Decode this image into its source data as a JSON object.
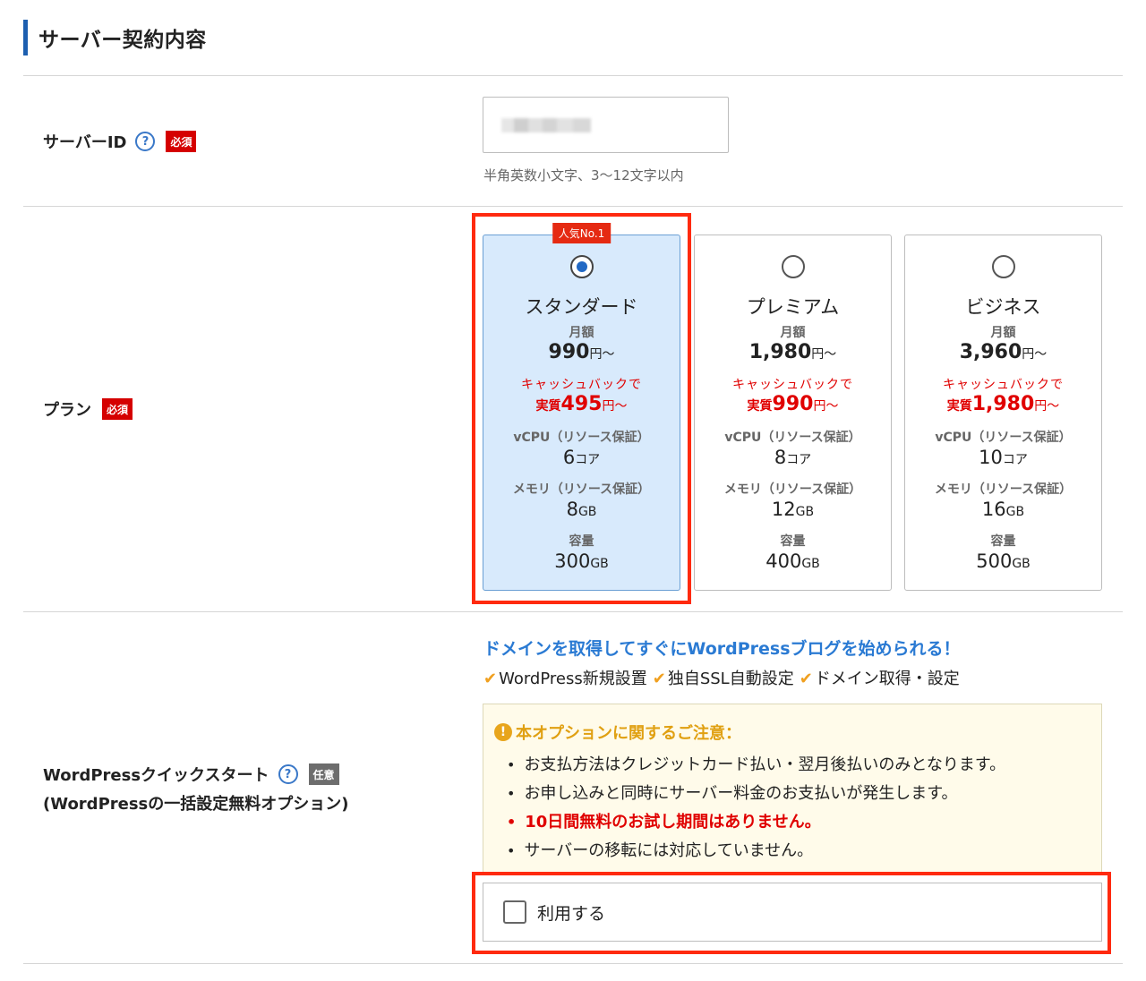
{
  "section": {
    "title": "サーバー契約内容"
  },
  "server_id": {
    "label": "サーバーID",
    "help_icon": "?",
    "required_badge": "必須",
    "hint": "半角英数小文字、3〜12文字以内"
  },
  "plan": {
    "label": "プラン",
    "required_badge": "必須",
    "popular_badge": "人気No.1",
    "selected": "スタンダード",
    "cards": [
      {
        "name": "スタンダード",
        "monthly_label": "月額",
        "price": "990",
        "price_unit": "円〜",
        "cashback_text": "キャッシュバックで",
        "real_prefix": "実質",
        "real_price": "495",
        "real_unit": "円〜",
        "vcpu_label": "vCPU（リソース保証）",
        "vcpu": "6",
        "vcpu_unit": "コア",
        "memory_label": "メモリ（リソース保証）",
        "memory": "8",
        "memory_unit": "GB",
        "storage_label": "容量",
        "storage": "300",
        "storage_unit": "GB"
      },
      {
        "name": "プレミアム",
        "monthly_label": "月額",
        "price": "1,980",
        "price_unit": "円〜",
        "cashback_text": "キャッシュバックで",
        "real_prefix": "実質",
        "real_price": "990",
        "real_unit": "円〜",
        "vcpu_label": "vCPU（リソース保証）",
        "vcpu": "8",
        "vcpu_unit": "コア",
        "memory_label": "メモリ（リソース保証）",
        "memory": "12",
        "memory_unit": "GB",
        "storage_label": "容量",
        "storage": "400",
        "storage_unit": "GB"
      },
      {
        "name": "ビジネス",
        "monthly_label": "月額",
        "price": "3,960",
        "price_unit": "円〜",
        "cashback_text": "キャッシュバックで",
        "real_prefix": "実質",
        "real_price": "1,980",
        "real_unit": "円〜",
        "vcpu_label": "vCPU（リソース保証）",
        "vcpu": "10",
        "vcpu_unit": "コア",
        "memory_label": "メモリ（リソース保証）",
        "memory": "16",
        "memory_unit": "GB",
        "storage_label": "容量",
        "storage": "500",
        "storage_unit": "GB"
      }
    ]
  },
  "wordpress": {
    "label_line1": "WordPressクイックスタート",
    "label_line2": "(WordPressの一括設定無料オプション)",
    "optional_badge": "任意",
    "lead": "ドメインを取得してすぐにWordPressブログを始められる！",
    "features": [
      "WordPress新規設置",
      "独自SSL自動設定",
      "ドメイン取得・設定"
    ],
    "notice_title": "本オプションに関するご注意：",
    "notice_items": [
      "お支払方法はクレジットカード払い・翌月後払いのみとなります。",
      "お申し込みと同時にサーバー料金のお支払いが発生します。",
      "10日間無料のお試し期間はありません。",
      "サーバーの移転には対応していません。"
    ],
    "use_label": "利用する",
    "use_checked": false
  },
  "colors": {
    "accent_blue": "#1d5fb0",
    "selected_bg": "#d8eafc",
    "required_red": "#d50000",
    "highlight_red": "#ff2a0f",
    "price_red": "#e00000",
    "lead_blue": "#2a7ad3",
    "notice_bg": "#fffbea"
  }
}
